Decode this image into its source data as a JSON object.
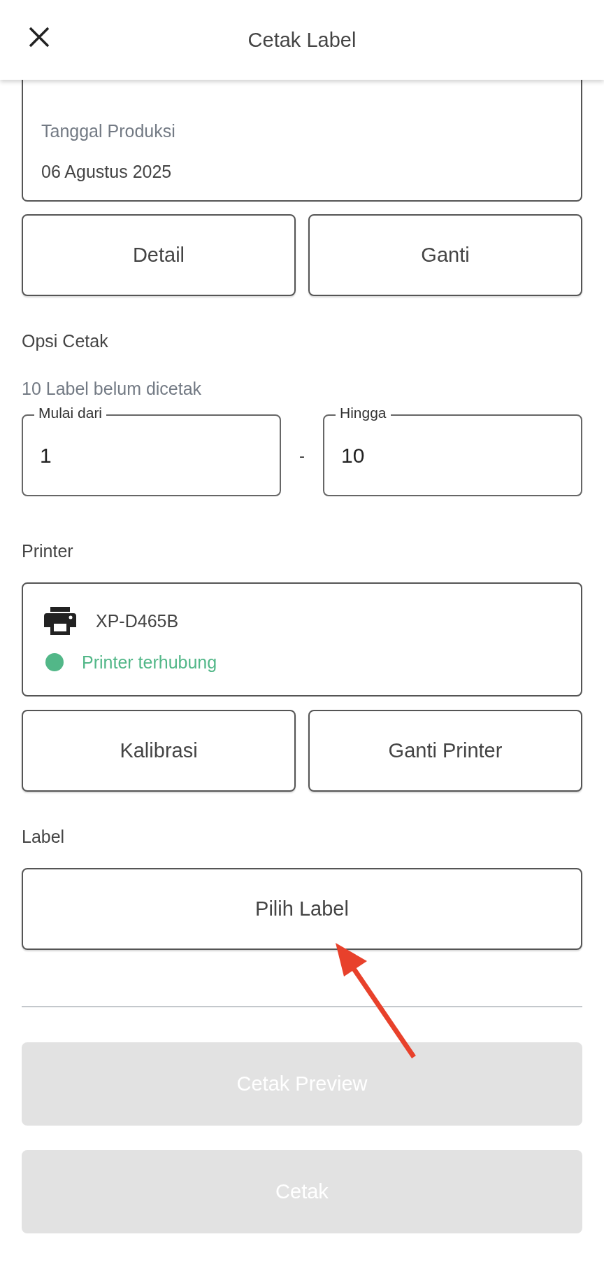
{
  "header": {
    "title": "Cetak Label"
  },
  "summary": {
    "date_label": "Tanggal Produksi",
    "date_value": "06 Agustus 2025"
  },
  "summary_buttons": [
    "Detail",
    "Ganti"
  ],
  "print_options": {
    "heading": "Opsi Cetak",
    "hint": "10 Label belum dicetak",
    "separator": "-",
    "fields": [
      {
        "label": "Mulai dari",
        "value": "1"
      },
      {
        "label": "Hingga",
        "value": "10"
      }
    ]
  },
  "printer": {
    "heading": "Printer",
    "name": "XP-D465B",
    "status": "Printer terhubung",
    "color": "#52b788",
    "buttons": [
      "Kalibrasi",
      "Ganti Printer"
    ]
  },
  "label": {
    "heading": "Label",
    "button": "Pilih Label"
  },
  "actions": [
    {
      "label": "Cetak Preview",
      "disabled": true
    },
    {
      "label": "Cetak",
      "disabled": true
    }
  ]
}
